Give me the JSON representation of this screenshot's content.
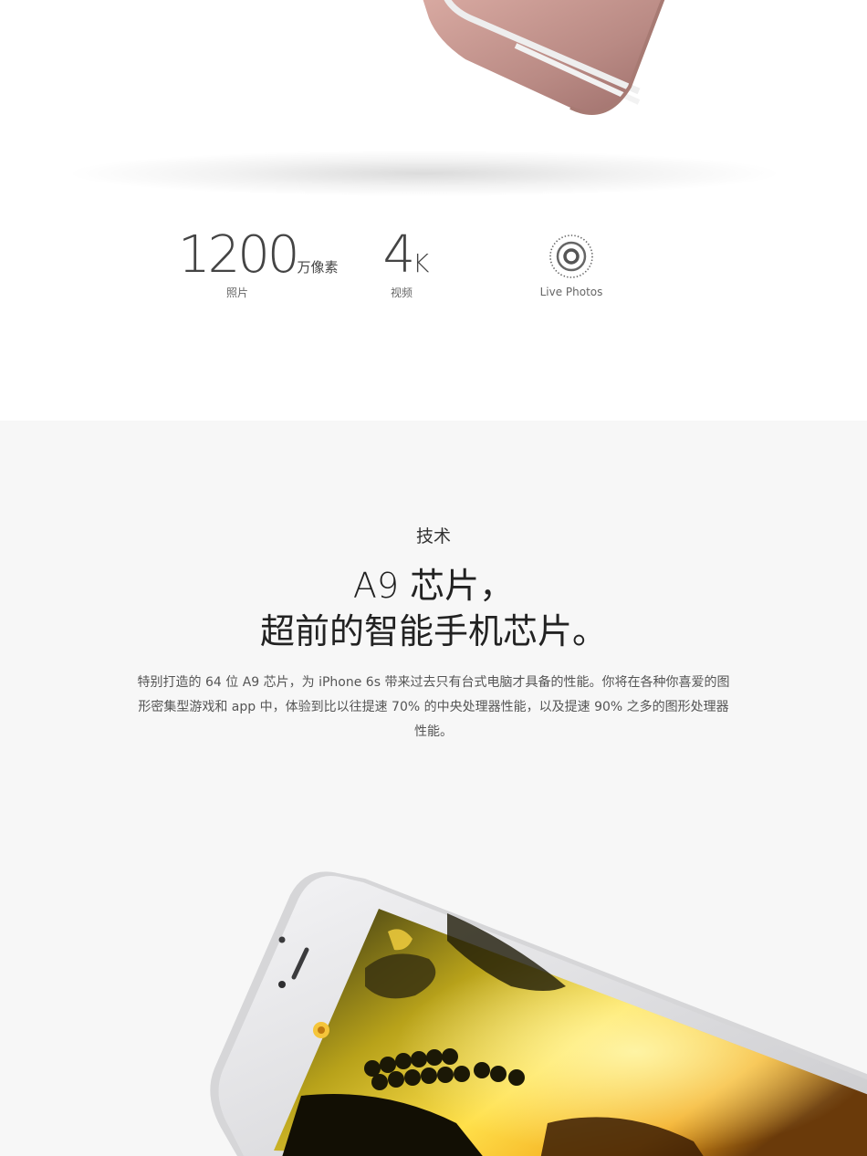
{
  "stats": {
    "megapixels": {
      "number": "1200",
      "unit": "万像素",
      "label": "照片"
    },
    "video": {
      "number": "4",
      "unit": "K",
      "label": "视频"
    },
    "live": {
      "icon": "live-photos-icon",
      "label": "Live Photos"
    }
  },
  "tech": {
    "eyebrow": "技术",
    "headline_line1": "A9 芯片，",
    "headline_line2": "超前的智能手机芯片。",
    "body": "特别打造的 64 位 A9 芯片，为 iPhone 6s 带来过去只有台式电脑才具备的性能。你将在各种你喜爱的图形密集型游戏和 app 中，体验到比以往提速 70% 的中央处理器性能，以及提速 90% 之多的图形处理器性能。"
  },
  "colors": {
    "rose_gold": "#c79a92",
    "silver": "#e6e6e8",
    "section_bg": "#f7f7f7"
  }
}
